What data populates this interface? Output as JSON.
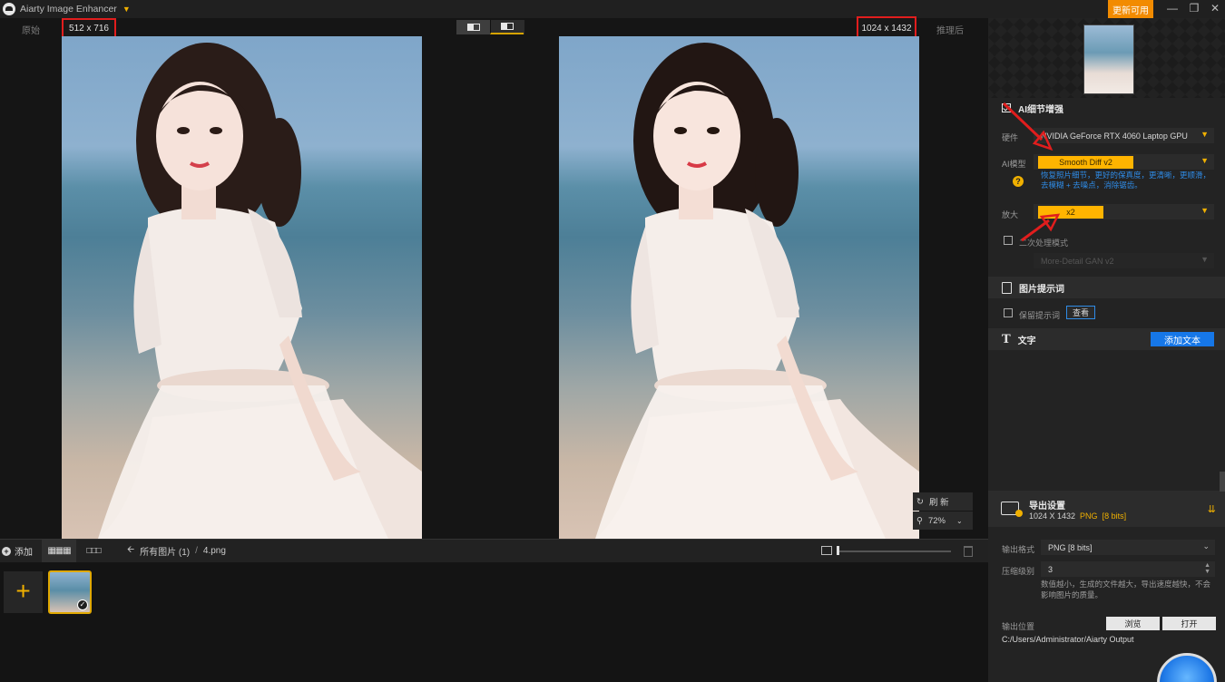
{
  "app": {
    "title": "Aiarty Image Enhancer",
    "update_label": "更新可用",
    "window_controls": [
      "minimize-icon",
      "maximize-icon",
      "close-icon"
    ]
  },
  "viewer": {
    "original_label": "原始",
    "after_label": "推理后",
    "original_resolution": "512 x 716",
    "output_resolution": "1024 x 1432",
    "refresh_label": "刷 新",
    "zoom_level": "72%"
  },
  "filebar": {
    "add_label": "添加",
    "breadcrumb_all": "所有图片 (1)",
    "breadcrumb_sep": "/",
    "breadcrumb_file": "4.png"
  },
  "panel": {
    "ai_enhance": {
      "title": "AI细节增强",
      "hardware_label": "硬件",
      "hardware_value": "NVIDIA GeForce RTX 4060 Laptop GPU",
      "model_label": "AI模型",
      "model_value": "Smooth Diff v2",
      "model_hint": "恢复照片细节，更好的保真度，更清晰，更顺滑，去模糊 + 去噪点，消除锯齿。",
      "scale_label": "放大",
      "scale_value": "x2",
      "second_pass_label": "二次处理模式",
      "second_pass_model": "More-Detail GAN v2"
    },
    "prompt": {
      "title": "图片提示词",
      "keep_label": "保留提示词",
      "view_label": "查看"
    },
    "text": {
      "title": "文字",
      "add_text_label": "添加文本"
    },
    "export": {
      "title": "导出设置",
      "resolution": "1024 X 1432",
      "format_short": "PNG",
      "bits": "[8 bits]",
      "format_label": "输出格式",
      "format_value": "PNG   [8 bits]",
      "compression_label": "压缩级别",
      "compression_value": "3",
      "compression_desc": "数值越小，生成的文件越大，导出速度越快，不会影响图片的质量。",
      "location_label": "输出位置",
      "browse_label": "浏览",
      "open_label": "打开",
      "path": "C:/Users/Administrator/Aiarty Output"
    }
  },
  "colors": {
    "accent": "#ffb400",
    "highlight_box": "#e11d1d",
    "link_blue": "#2f8be6",
    "primary_button": "#1677e8",
    "update_orange": "#f28b00"
  }
}
